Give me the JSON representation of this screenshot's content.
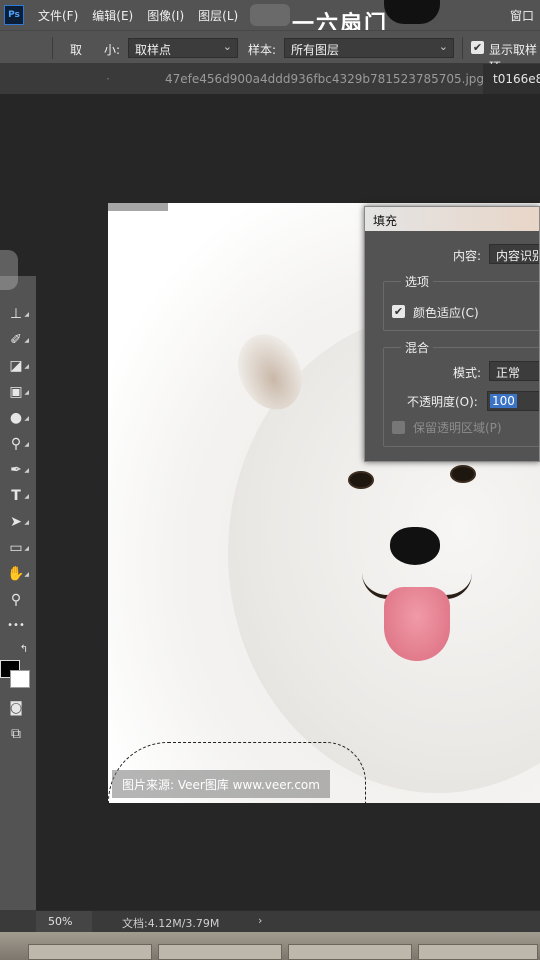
{
  "menubar": {
    "app_icon": "Ps",
    "items": [
      "文件(F)",
      "编辑(E)",
      "图像(I)",
      "图层(L)"
    ],
    "title_overlay": "一六扇门",
    "window_menu": "窗口"
  },
  "options_bar": {
    "sample_size_label_left": "取",
    "sample_size_label_right": "小:",
    "sample_size_value": "取样点",
    "sample_label": "样本:",
    "sample_value": "所有图层",
    "show_ring_label": "显示取样环",
    "show_ring_checked": true
  },
  "tabs": [
    {
      "label": "47efe456d900a4ddd936fbc4329b781523785705.jpg",
      "active": false,
      "close": "×"
    },
    {
      "label": "t0166e8",
      "active": true
    }
  ],
  "toolbar": {
    "tools": [
      "stamp-icon",
      "history-brush-icon",
      "eraser-icon",
      "gradient-icon",
      "blur-icon",
      "dodge-icon",
      "pen-icon",
      "type-icon",
      "path-select-icon",
      "rectangle-icon",
      "hand-icon",
      "zoom-icon",
      "more-icon",
      "swap-colors-icon",
      "quick-mask-icon",
      "screen-mode-icon"
    ],
    "type_glyph": "T",
    "more_glyph": "•••"
  },
  "canvas": {
    "watermark": "图片来源: Veer图库 www.veer.com"
  },
  "fill_dialog": {
    "title": "填充",
    "content_label": "内容:",
    "content_value": "内容识别",
    "options_legend": "选项",
    "color_adapt_label": "颜色适应(C)",
    "color_adapt_checked": true,
    "blend_legend": "混合",
    "mode_label": "模式:",
    "mode_value": "正常",
    "opacity_label": "不透明度(O):",
    "opacity_value": "100",
    "preserve_label": "保留透明区域(P)",
    "preserve_checked": false
  },
  "statusbar": {
    "zoom": "50%",
    "doc_info": "文档:4.12M/3.79M",
    "arrow": "›"
  }
}
